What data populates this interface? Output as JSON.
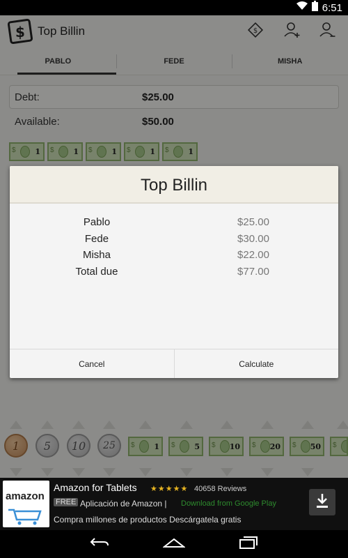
{
  "status_bar": {
    "time": "6:51"
  },
  "app": {
    "title": "Top Billin"
  },
  "tabs": [
    {
      "label": "PABLO"
    },
    {
      "label": "FEDE"
    },
    {
      "label": "MISHA"
    }
  ],
  "summary": {
    "debt_label": "Debt:",
    "debt_value": "$25.00",
    "available_label": "Available:",
    "available_value": "$50.00"
  },
  "bill_row_values": [
    "1",
    "1",
    "1",
    "1",
    "1"
  ],
  "coins": [
    "1",
    "5",
    "10",
    "25"
  ],
  "bills": [
    "1",
    "5",
    "10",
    "20",
    "50",
    "1"
  ],
  "dialog": {
    "title": "Top Billin",
    "rows": [
      {
        "name": "Pablo",
        "amount": "$25.00"
      },
      {
        "name": "Fede",
        "amount": "$30.00"
      },
      {
        "name": "Misha",
        "amount": "$22.00"
      },
      {
        "name": "Total due",
        "amount": "$77.00"
      }
    ],
    "cancel_label": "Cancel",
    "calculate_label": "Calculate"
  },
  "ad": {
    "thumb_text": "amazon",
    "title": "Amazon for Tablets",
    "stars": "★★★★★",
    "reviews": "40658 Reviews",
    "free_badge": "FREE",
    "subtitle": "Aplicación de Amazon |",
    "link": "Download from Google Play",
    "description": "Compra millones de productos Descárgatela gratis"
  },
  "colors": {
    "accent_green": "#8fb36d",
    "bill_fill": "#cfe2b8",
    "dialog_header": "#f1eee5",
    "ad_link": "#2e8b2e"
  }
}
